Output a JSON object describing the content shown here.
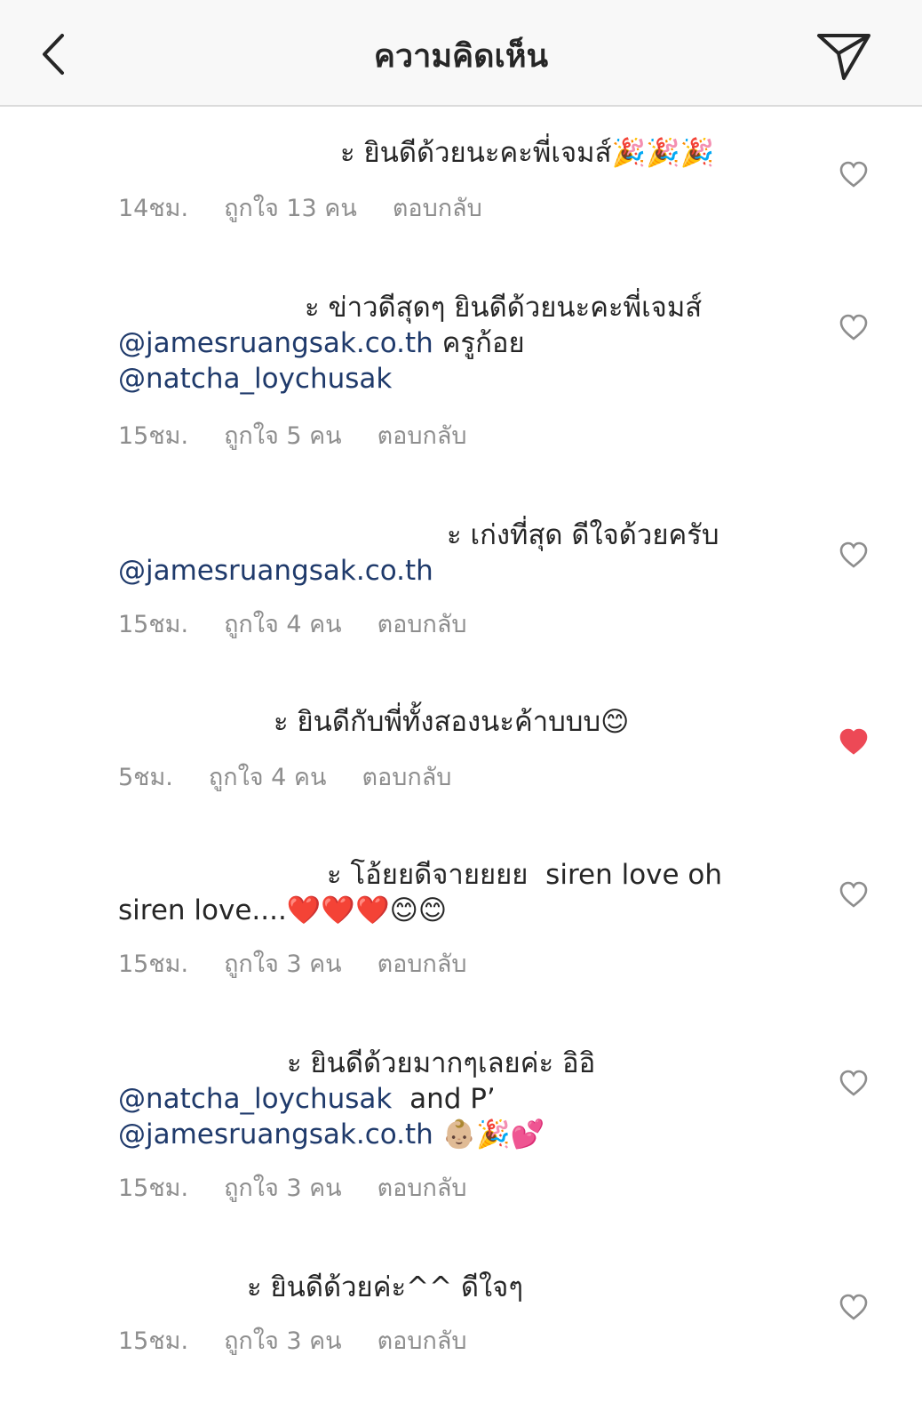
{
  "header": {
    "title": "ความคิดเห็น"
  },
  "comments": [
    {
      "prefix": "ะ ",
      "text": "ยินดีด้วยนะคะพี่เจมส์🎉🎉🎉",
      "time": "14ชม.",
      "likes": "ถูกใจ 13 คน",
      "reply": "ตอบกลับ",
      "liked": false
    },
    {
      "prefix": "ะ ",
      "text": "ข่าวดีสุดๆ ยินดีด้วยนะคะพี่เจมส์",
      "mention1": "@jamesruangsak.co.th",
      "after1": " ครูก้อย",
      "mention2": "@natcha_loychusak",
      "time": "15ชม.",
      "likes": "ถูกใจ 5 คน",
      "reply": "ตอบกลับ",
      "liked": false
    },
    {
      "prefix": "ะ ",
      "text": "เก่งที่สุด ดีใจด้วยครับ",
      "mention1": "@jamesruangsak.co.th",
      "time": "15ชม.",
      "likes": "ถูกใจ 4 คน",
      "reply": "ตอบกลับ",
      "liked": false
    },
    {
      "prefix": "ะ ",
      "text": "ยินดีกับพี่ทั้งสองนะค้าบบบ😊",
      "time": "5ชม.",
      "likes": "ถูกใจ 4 คน",
      "reply": "ตอบกลับ",
      "liked": true
    },
    {
      "prefix": "ะ ",
      "text": "โอ้ยยดีจายยยย  siren love oh",
      "line2": "siren love....❤️❤️❤️😊😊",
      "time": "15ชม.",
      "likes": "ถูกใจ 3 คน",
      "reply": "ตอบกลับ",
      "liked": false
    },
    {
      "prefix": "ะ ",
      "text": "ยินดีด้วยมากๆเลยค่ะ อิอิ",
      "mention1": "@natcha_loychusak",
      "after1": "  and P’",
      "mention2": "@jamesruangsak.co.th",
      "after2": " 👶🏼🎉💕",
      "time": "15ชม.",
      "likes": "ถูกใจ 3 คน",
      "reply": "ตอบกลับ",
      "liked": false
    },
    {
      "prefix": "ะ ",
      "text": "ยินดีด้วยค่ะ^^ ดีใจๆ",
      "time": "15ชม.",
      "likes": "ถูกใจ 3 คน",
      "reply": "ตอบกลับ",
      "liked": false
    }
  ],
  "colors": {
    "mention": "#1f3a6b",
    "heart_liked": "#ed4956",
    "meta": "#8e8e8e"
  },
  "icons": {
    "back": "chevron-left-icon",
    "send": "paper-plane-icon",
    "like": "heart-icon"
  }
}
